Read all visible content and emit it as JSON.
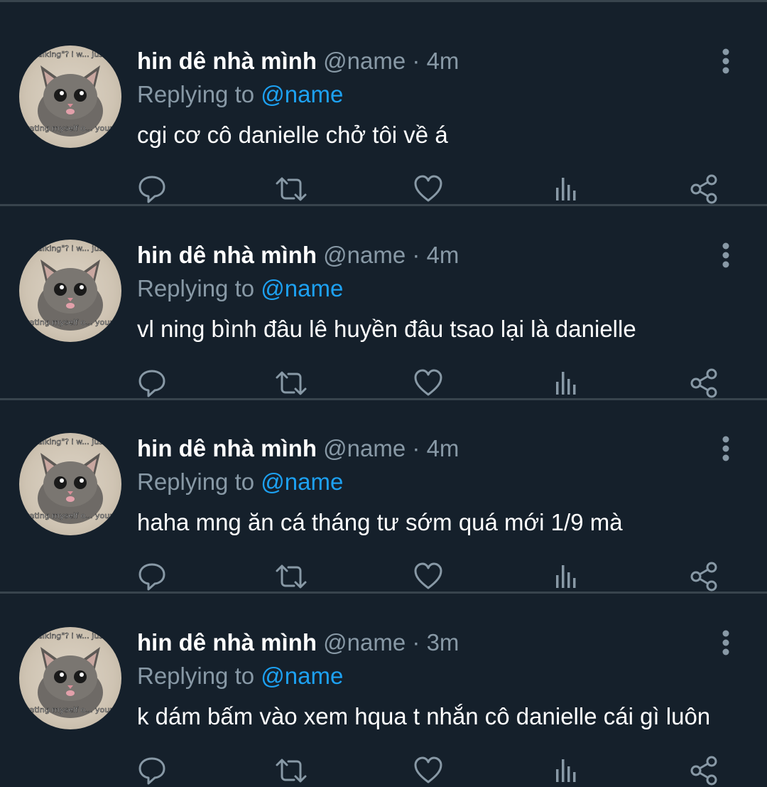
{
  "colors": {
    "background": "#15202b",
    "divider": "#38444d",
    "name": "#ffffff",
    "muted": "#8899a6",
    "accent": "#1da1f2"
  },
  "icons": {
    "more": "more-vertical-icon",
    "reply": "reply-icon",
    "retweet": "retweet-icon",
    "like": "heart-icon",
    "stats": "analytics-icon",
    "share": "share-icon"
  },
  "tweets": [
    {
      "display_name": "hin dê nhà mình",
      "handle": "@name",
      "separator": "·",
      "time": "4m",
      "reply_prefix": "Replying to ",
      "reply_handle": "@name",
      "text": "cgi cơ cô danielle chở tôi về á",
      "avatar_caption_top": "talking\"? i w... just",
      "avatar_caption_bottom": "educating myself o... your lore"
    },
    {
      "display_name": "hin dê nhà mình",
      "handle": "@name",
      "separator": "·",
      "time": "4m",
      "reply_prefix": "Replying to ",
      "reply_handle": "@name",
      "text": "vl ning bình đâu lê huyền đâu tsao lại là danielle",
      "avatar_caption_top": "talking\"? i w... just",
      "avatar_caption_bottom": "educating myself o... your lore"
    },
    {
      "display_name": "hin dê nhà mình",
      "handle": "@name",
      "separator": "·",
      "time": "4m",
      "reply_prefix": "Replying to ",
      "reply_handle": "@name",
      "text": "haha mng ăn cá tháng tư sớm quá mới 1/9 mà",
      "avatar_caption_top": "talking\"? i w... just",
      "avatar_caption_bottom": "educating myself o... your lore"
    },
    {
      "display_name": "hin dê nhà mình",
      "handle": "@name",
      "separator": "·",
      "time": "3m",
      "reply_prefix": "Replying to ",
      "reply_handle": "@name",
      "text": "k dám bấm vào xem hqua t nhắn cô danielle cái gì luôn",
      "avatar_caption_top": "talking\"? i w... just",
      "avatar_caption_bottom": "educating myself o... your lore"
    }
  ]
}
